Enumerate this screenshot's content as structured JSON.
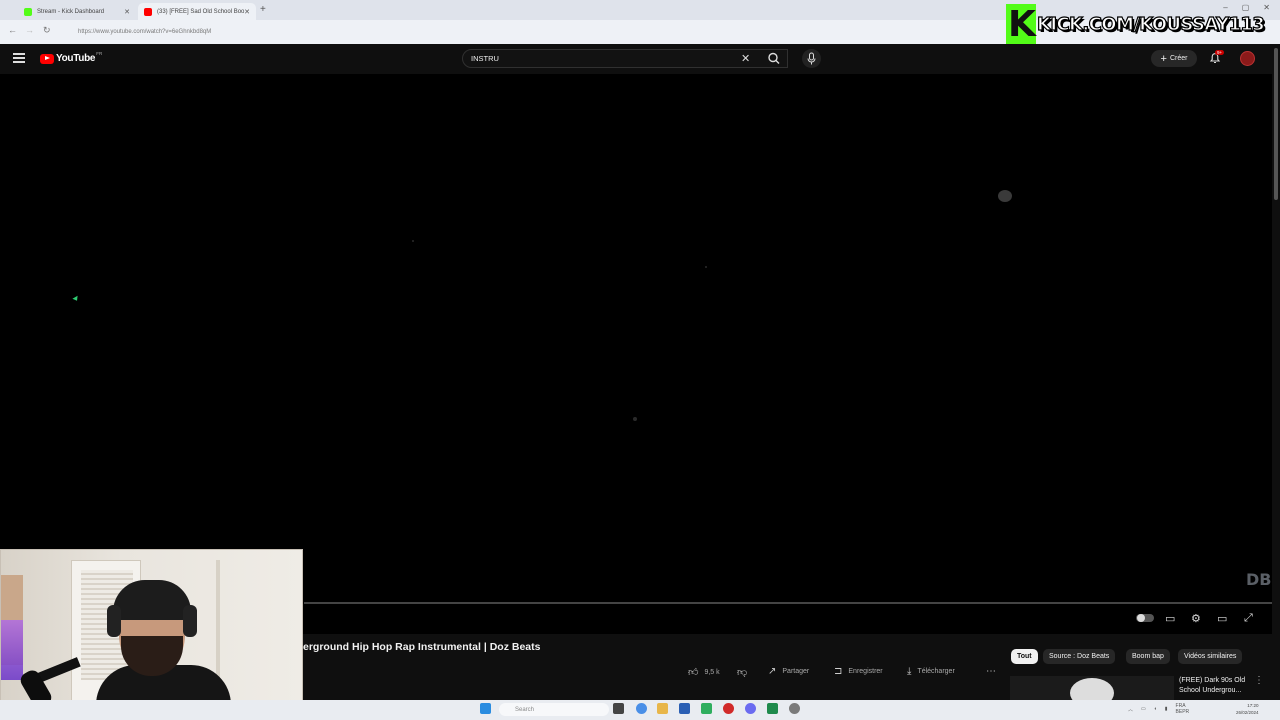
{
  "browser": {
    "tabs": [
      {
        "title": "Stream - Kick Dashboard",
        "favicon_color": "#53fc18"
      },
      {
        "title": "(33) [FREE] Sad Old School Boo",
        "favicon_color": "#ff0000"
      }
    ],
    "new_tab": "+",
    "url": "https://www.youtube.com/watch?v=6eGhnkbd8qM",
    "window_controls": [
      "–",
      "▢",
      "✕"
    ]
  },
  "overlay": {
    "kick_text": "KICK.COM/KOUSSAY113",
    "kick_color": "#53fc18"
  },
  "youtube": {
    "logo_word": "YouTube",
    "region": "FR",
    "search_value": "INSTRU",
    "create_label": "Créer",
    "notif_badge": "9+",
    "brand_red": "#ff0000"
  },
  "player": {
    "watermark": "DB"
  },
  "video": {
    "title": "erground Hip Hop Rap Instrumental | Doz Beats",
    "likes": "9,5 k",
    "share_label": "Partager",
    "save_label": "Enregistrer",
    "download_label": "Télécharger",
    "more": "⋯"
  },
  "chips": [
    "Tout",
    "Source : Doz Beats",
    "Boom bap",
    "Vidéos similaires"
  ],
  "suggestion": {
    "title": "(FREE) Dark 90s Old School Undergrou..."
  },
  "taskbar": {
    "search_placeholder": "Search",
    "lang": "FRA\nBEPR",
    "time": "17:20",
    "date": "26/02/2024"
  }
}
